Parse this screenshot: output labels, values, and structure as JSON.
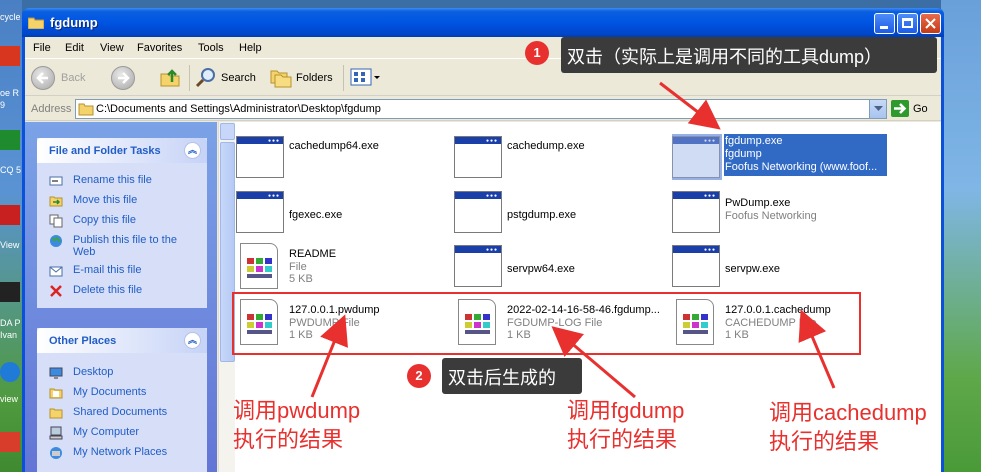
{
  "desktop": {
    "fragments": [
      "cycle",
      "oe R",
      "9",
      "CQ 5",
      "View",
      "DA P",
      "Ivan",
      "view"
    ]
  },
  "window": {
    "title": "fgdump",
    "menu": [
      "File",
      "Edit",
      "View",
      "Favorites",
      "Tools",
      "Help"
    ],
    "toolbar": {
      "back": "Back",
      "search": "Search",
      "folders": "Folders"
    },
    "address": {
      "label": "Address",
      "path": "C:\\Documents and Settings\\Administrator\\Desktop\\fgdump",
      "go": "Go"
    }
  },
  "sidebar": {
    "file_tasks": {
      "title": "File and Folder Tasks",
      "items": [
        "Rename this file",
        "Move this file",
        "Copy this file",
        "Publish this file to the",
        "Web",
        "E-mail this file",
        "Delete this file"
      ]
    },
    "other_places": {
      "title": "Other Places",
      "items": [
        "Desktop",
        "My Documents",
        "Shared Documents",
        "My Computer",
        "My Network Places"
      ]
    }
  },
  "files": [
    {
      "name": "cachedump64.exe",
      "l2": "",
      "l3": ""
    },
    {
      "name": "cachedump.exe",
      "l2": "",
      "l3": ""
    },
    {
      "name": "fgdump.exe",
      "l2": "fgdump",
      "l3": "Foofus Networking (www.foof..."
    },
    {
      "name": "fgexec.exe",
      "l2": "",
      "l3": ""
    },
    {
      "name": "pstgdump.exe",
      "l2": "",
      "l3": ""
    },
    {
      "name": "PwDump.exe",
      "l2": "Foofus Networking",
      "l3": ""
    },
    {
      "name": "README",
      "l2": "File",
      "l3": "5 KB"
    },
    {
      "name": "servpw64.exe",
      "l2": "",
      "l3": ""
    },
    {
      "name": "servpw.exe",
      "l2": "",
      "l3": ""
    },
    {
      "name": "127.0.0.1.pwdump",
      "l2": "PWDUMP File",
      "l3": "1 KB"
    },
    {
      "name": "2022-02-14-16-58-46.fgdump...",
      "l2": "FGDUMP-LOG File",
      "l3": "1 KB"
    },
    {
      "name": "127.0.0.1.cachedump",
      "l2": "CACHEDUMP File",
      "l3": "1 KB"
    }
  ],
  "annotations": {
    "a1_num": "1",
    "a1_text": "双击（实际上是调用不同的工具dump）",
    "a2_num": "2",
    "a2_text": "双击后生成的",
    "label_pwdump_1": "调用pwdump",
    "label_pwdump_2": "执行的结果",
    "label_fgdump_1": "调用fgdump",
    "label_fgdump_2": "执行的结果",
    "label_cachedump_1": "调用cachedump",
    "label_cachedump_2": "执行的结果"
  },
  "colors": {
    "accent": "#e8312f",
    "titlebar": "#0054e3",
    "selection": "#316ac5",
    "link": "#215dc6"
  }
}
